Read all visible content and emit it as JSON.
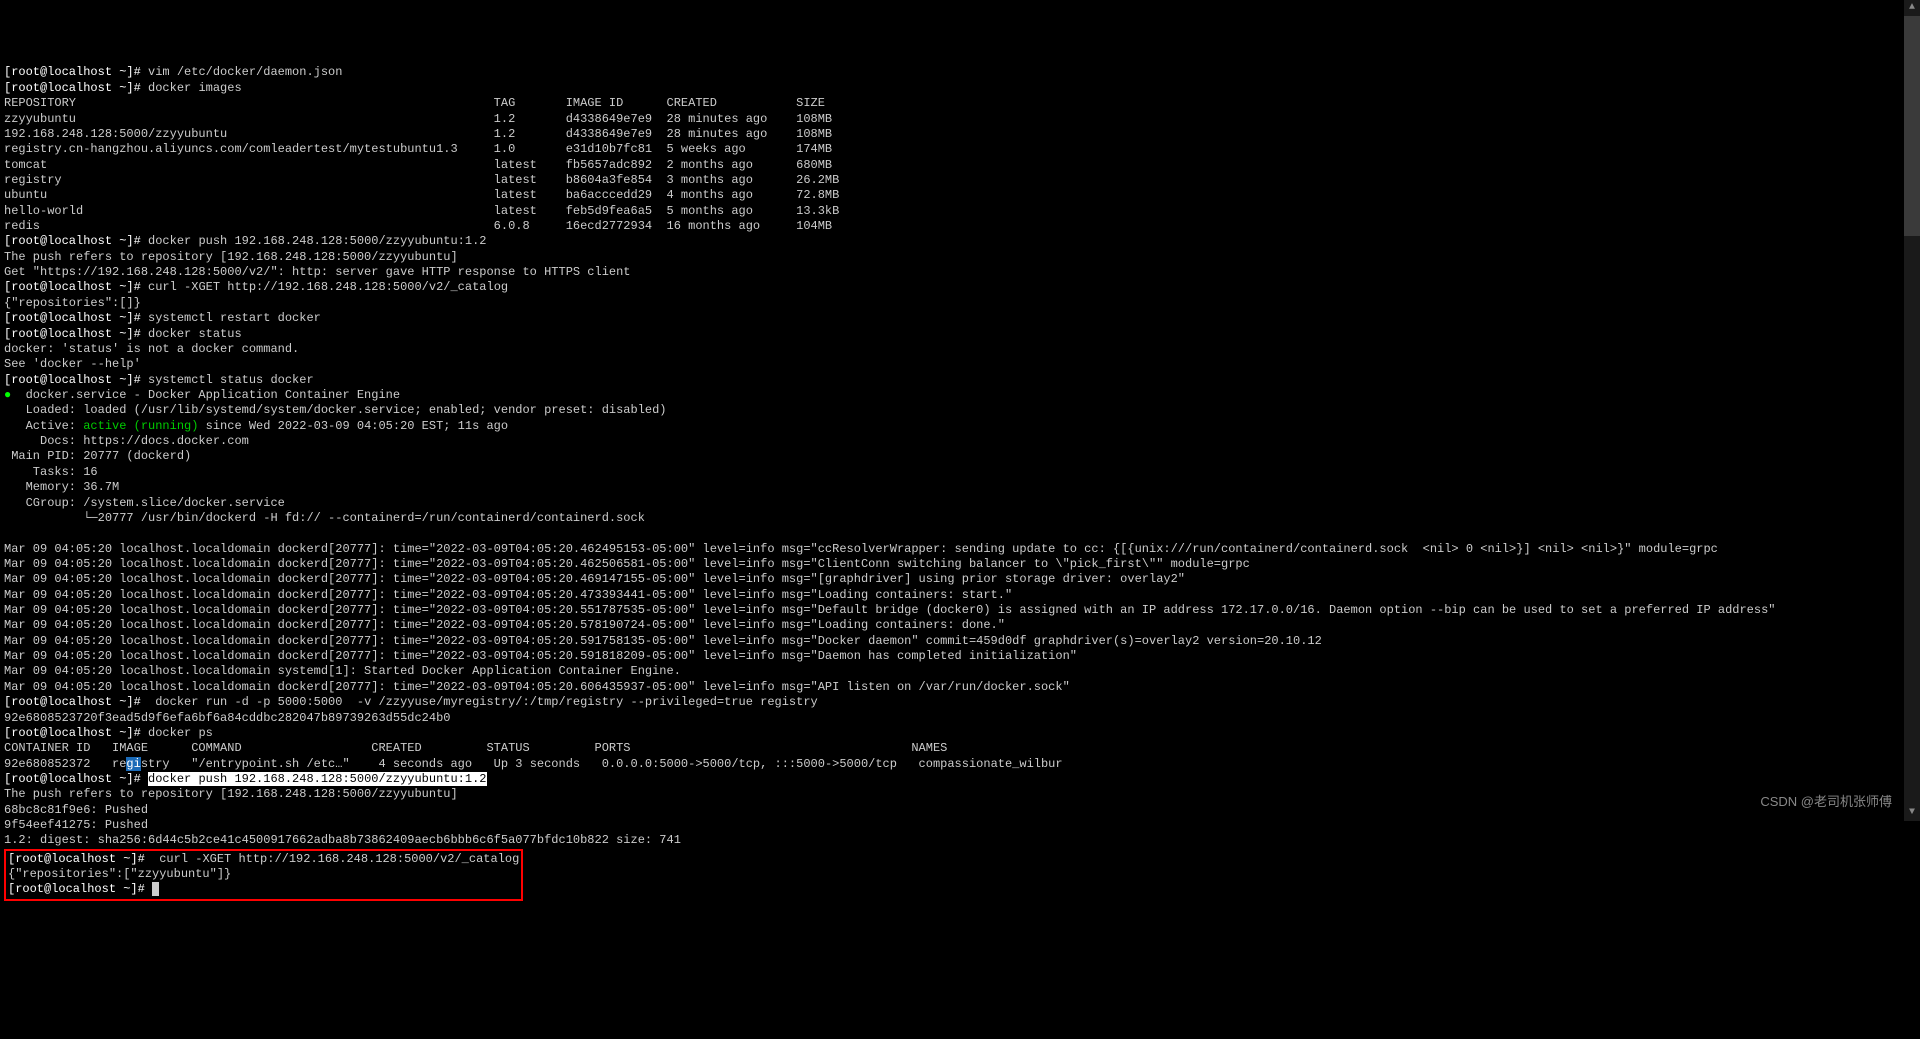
{
  "prompt_prefix": "[root@localhost ~]# ",
  "cmds": {
    "vim": "vim /etc/docker/daemon.json",
    "images": "docker images",
    "push1": "docker push 192.168.248.128:5000/zzyyubuntu:1.2",
    "curl1": "curl -XGET http://192.168.248.128:5000/v2/_catalog",
    "restart": "systemctl restart docker",
    "dstatus": "docker status",
    "sstatus": "systemctl status docker",
    "run": " docker run -d -p 5000:5000  -v /zzyyuse/myregistry/:/tmp/registry --privileged=true registry",
    "ps": "docker ps",
    "push2": "docker push 192.168.248.128:5000/zzyyubuntu:1.2",
    "curl2": " curl -XGET http://192.168.248.128:5000/v2/_catalog"
  },
  "images_table": {
    "header": [
      "REPOSITORY",
      "TAG",
      "IMAGE ID",
      "CREATED",
      "SIZE"
    ],
    "rows": [
      [
        "zzyyubuntu",
        "1.2",
        "d4338649e7e9",
        "28 minutes ago",
        "108MB"
      ],
      [
        "192.168.248.128:5000/zzyyubuntu",
        "1.2",
        "d4338649e7e9",
        "28 minutes ago",
        "108MB"
      ],
      [
        "registry.cn-hangzhou.aliyuncs.com/comleadertest/mytestubuntu1.3",
        "1.0",
        "e31d10b7fc81",
        "5 weeks ago",
        "174MB"
      ],
      [
        "tomcat",
        "latest",
        "fb5657adc892",
        "2 months ago",
        "680MB"
      ],
      [
        "registry",
        "latest",
        "b8604a3fe854",
        "3 months ago",
        "26.2MB"
      ],
      [
        "ubuntu",
        "latest",
        "ba6acccedd29",
        "4 months ago",
        "72.8MB"
      ],
      [
        "hello-world",
        "latest",
        "feb5d9fea6a5",
        "5 months ago",
        "13.3kB"
      ],
      [
        "redis",
        "6.0.8",
        "16ecd2772934",
        "16 months ago",
        "104MB"
      ]
    ]
  },
  "push1_out": [
    "The push refers to repository [192.168.248.128:5000/zzyyubuntu]",
    "Get \"https://192.168.248.128:5000/v2/\": http: server gave HTTP response to HTTPS client"
  ],
  "curl1_out": "{\"repositories\":[]}",
  "dstatus_out": [
    "docker: 'status' is not a docker command.",
    "See 'docker --help'"
  ],
  "service": {
    "hdr": "docker.service - Docker Application Container Engine",
    "loaded": "   Loaded: loaded (/usr/lib/systemd/system/docker.service; enabled; vendor preset: disabled)",
    "active_lbl": "   Active: ",
    "active_val": "active (running)",
    "active_rest": " since Wed 2022-03-09 04:05:20 EST; 11s ago",
    "docs": "     Docs: https://docs.docker.com",
    "pid": " Main PID: 20777 (dockerd)",
    "tasks": "    Tasks: 16",
    "mem": "   Memory: 36.7M",
    "cgroup": "   CGroup: /system.slice/docker.service",
    "tree": "           └─20777 /usr/bin/dockerd -H fd:// --containerd=/run/containerd/containerd.sock"
  },
  "log_lines": [
    "Mar 09 04:05:20 localhost.localdomain dockerd[20777]: time=\"2022-03-09T04:05:20.462495153-05:00\" level=info msg=\"ccResolverWrapper: sending update to cc: {[{unix:///run/containerd/containerd.sock  <nil> 0 <nil>}] <nil> <nil>}\" module=grpc",
    "Mar 09 04:05:20 localhost.localdomain dockerd[20777]: time=\"2022-03-09T04:05:20.462506581-05:00\" level=info msg=\"ClientConn switching balancer to \\\"pick_first\\\"\" module=grpc",
    "Mar 09 04:05:20 localhost.localdomain dockerd[20777]: time=\"2022-03-09T04:05:20.469147155-05:00\" level=info msg=\"[graphdriver] using prior storage driver: overlay2\"",
    "Mar 09 04:05:20 localhost.localdomain dockerd[20777]: time=\"2022-03-09T04:05:20.473393441-05:00\" level=info msg=\"Loading containers: start.\"",
    "Mar 09 04:05:20 localhost.localdomain dockerd[20777]: time=\"2022-03-09T04:05:20.551787535-05:00\" level=info msg=\"Default bridge (docker0) is assigned with an IP address 172.17.0.0/16. Daemon option --bip can be used to set a preferred IP address\"",
    "Mar 09 04:05:20 localhost.localdomain dockerd[20777]: time=\"2022-03-09T04:05:20.578190724-05:00\" level=info msg=\"Loading containers: done.\"",
    "Mar 09 04:05:20 localhost.localdomain dockerd[20777]: time=\"2022-03-09T04:05:20.591758135-05:00\" level=info msg=\"Docker daemon\" commit=459d0df graphdriver(s)=overlay2 version=20.10.12",
    "Mar 09 04:05:20 localhost.localdomain dockerd[20777]: time=\"2022-03-09T04:05:20.591818209-05:00\" level=info msg=\"Daemon has completed initialization\"",
    "Mar 09 04:05:20 localhost.localdomain systemd[1]: Started Docker Application Container Engine.",
    "Mar 09 04:05:20 localhost.localdomain dockerd[20777]: time=\"2022-03-09T04:05:20.606435937-05:00\" level=info msg=\"API listen on /var/run/docker.sock\""
  ],
  "run_out": "92e6808523720f3ead5d9f6efa6bf6a84cddbc282047b89739263d55dc24b0",
  "ps_table": {
    "header": [
      "CONTAINER ID",
      "IMAGE",
      "COMMAND",
      "CREATED",
      "STATUS",
      "PORTS",
      "NAMES"
    ],
    "row_pre": "92e680852372   re",
    "row_hlimg": "gi",
    "row_post": "stry   \"/entrypoint.sh /etc…\"    4 seconds ago   Up 3 seconds   0.0.0.0:5000->5000/tcp, :::5000->5000/tcp   compassionate_wilbur"
  },
  "push2_out": [
    "The push refers to repository [192.168.248.128:5000/zzyyubuntu]",
    "68bc8c81f9e6: Pushed",
    "9f54eef41275: Pushed",
    "1.2: digest: sha256:6d44c5b2ce41c4500917662adba8b73862409aecb6bbb6c6f5a077bfdc10b822 size: 741"
  ],
  "curl2_out": "{\"repositories\":[\"zzyyubuntu\"]}",
  "watermark": "CSDN @老司机张师傅"
}
